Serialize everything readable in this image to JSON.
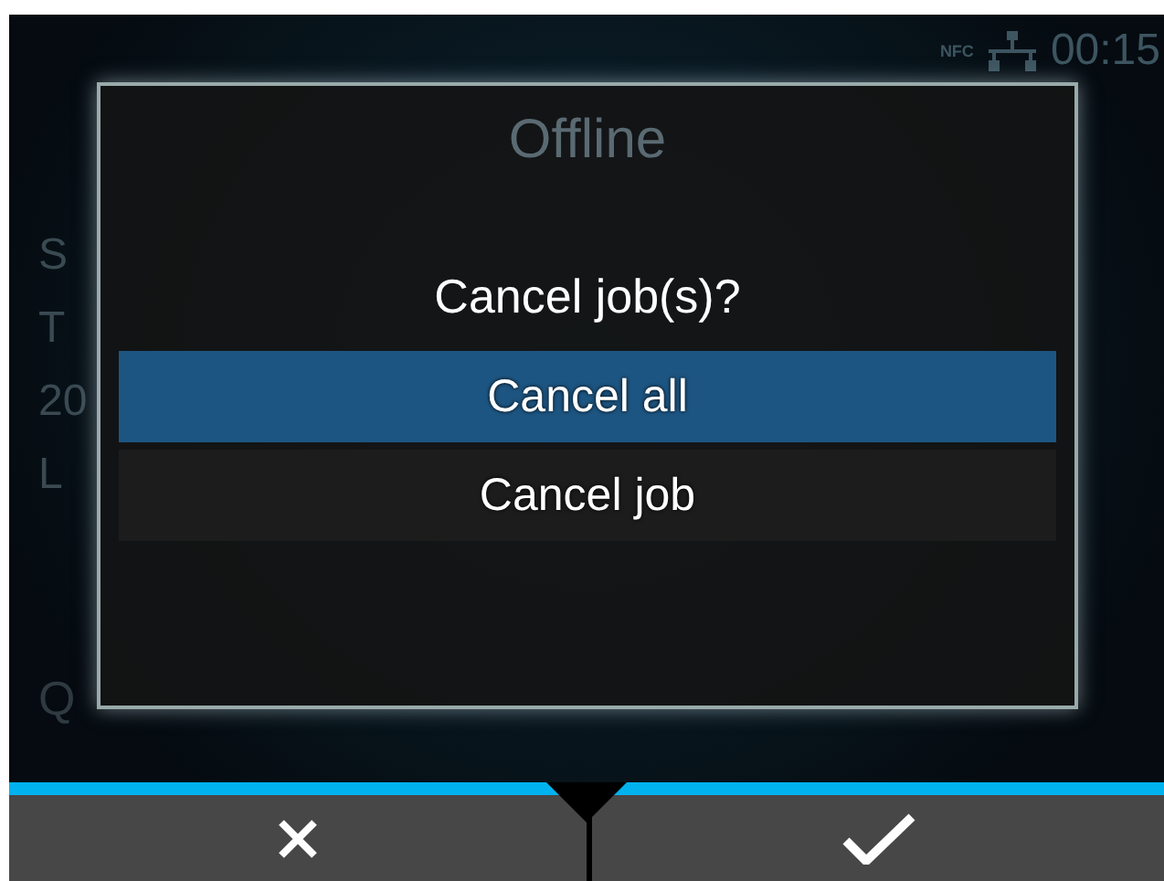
{
  "status_bar": {
    "nfc_label": "NFC",
    "time": "00:15"
  },
  "background": {
    "title": "Offline",
    "lines": [
      "S",
      "T",
      "20",
      "L"
    ],
    "footer": "Q"
  },
  "dialog": {
    "title": "Cancel job(s)?",
    "options": [
      {
        "label": "Cancel all",
        "selected": true
      },
      {
        "label": "Cancel job",
        "selected": false
      }
    ]
  },
  "softkeys": [
    {
      "kind": "cancel"
    },
    {
      "kind": "confirm"
    }
  ]
}
